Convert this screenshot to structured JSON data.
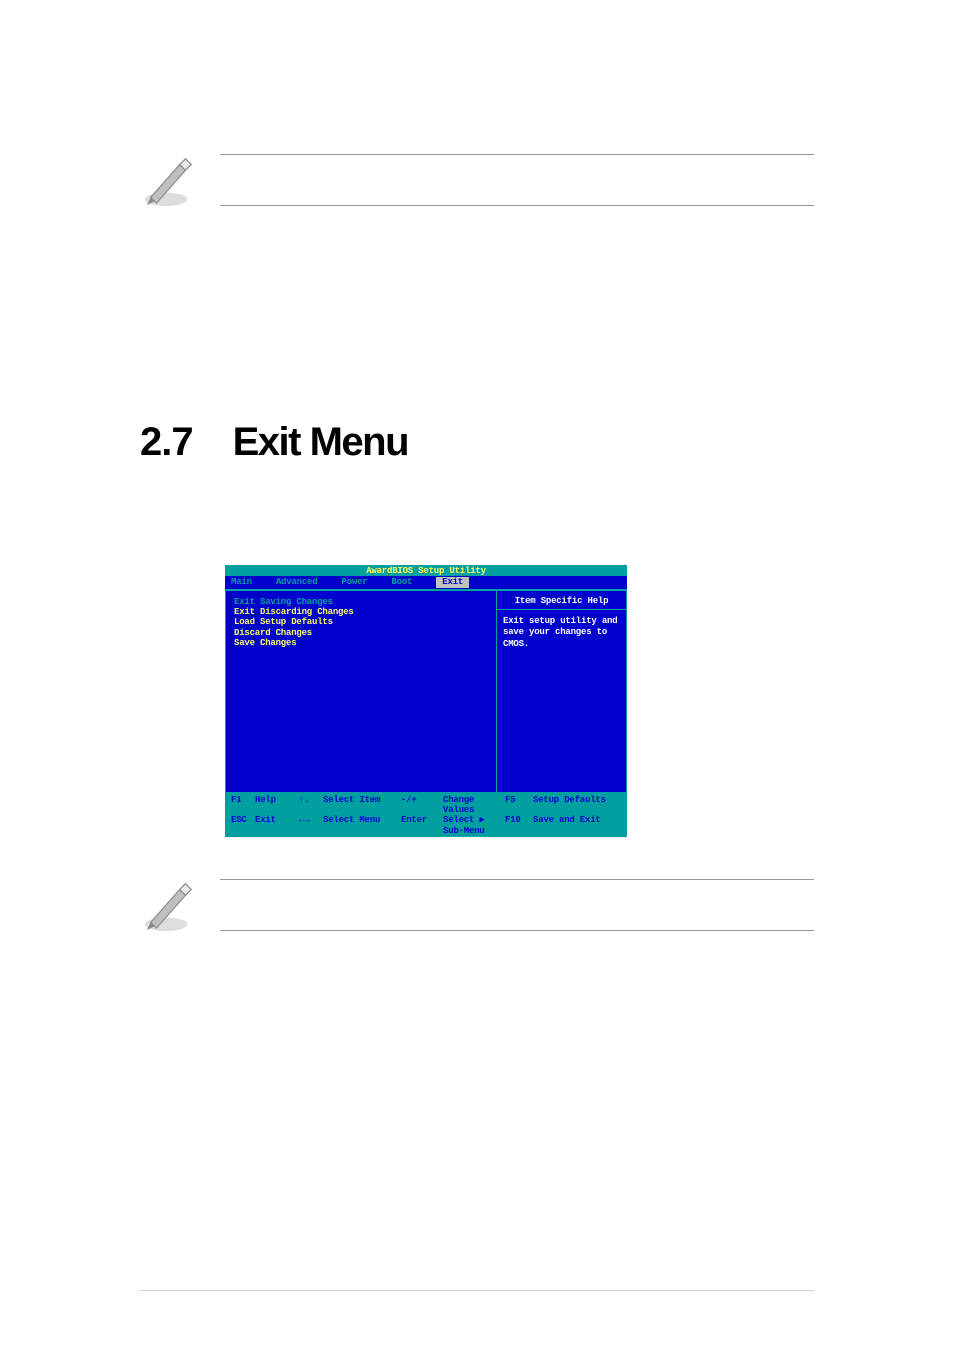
{
  "heading": {
    "number": "2.7",
    "title": "Exit Menu"
  },
  "bios": {
    "title": "AwardBIOS Setup Utility",
    "tabs": [
      "Main",
      "Advanced",
      "Power",
      "Boot",
      "Exit"
    ],
    "menu_items": [
      "Exit Saving Changes",
      "Exit Discarding Changes",
      "Load Setup Defaults",
      "Discard Changes",
      "Save Changes"
    ],
    "help_title": "Item Specific Help",
    "help_body": "Exit setup utility and save your changes to CMOS.",
    "footer": {
      "row1": {
        "k1": "F1",
        "l1": "Help",
        "a1": "↑↓",
        "t1": "Select Item",
        "k2": "-/+",
        "t2": "Change Values",
        "k3": "F5",
        "t3": "Setup Defaults"
      },
      "row2": {
        "k1": "ESC",
        "l1": "Exit",
        "a1": "←→",
        "t1": "Select Menu",
        "k2": "Enter",
        "t2": "Select ▶ Sub-Menu",
        "k3": "F10",
        "t3": "Save and Exit"
      }
    }
  }
}
